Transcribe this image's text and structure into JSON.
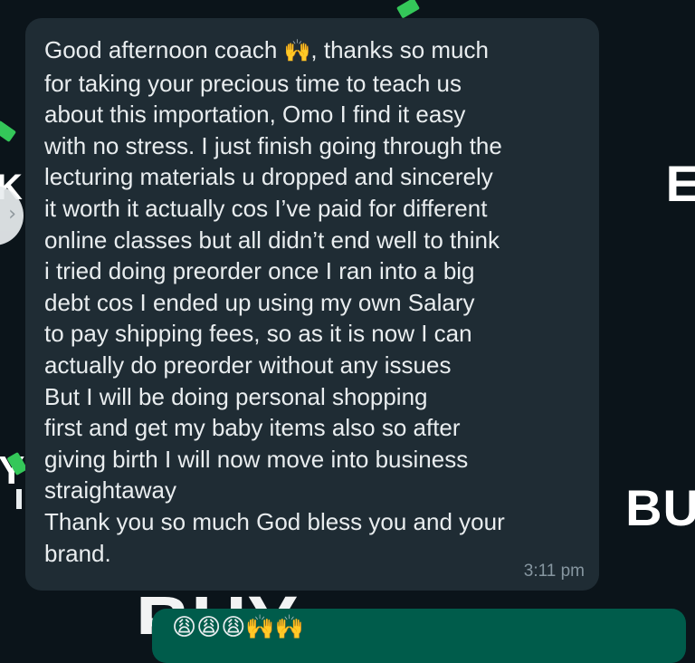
{
  "wallpaper": {
    "text_right_top": "E",
    "text_right_bottom": "BU",
    "text_bottom": "BUY",
    "text_left_top": "K",
    "text_left_bottom": "Y",
    "nav_arrow": "›"
  },
  "message": {
    "line_1a": "Good afternoon coach",
    "line_1_emoji": "🙌",
    "line_1b": ", thanks so much",
    "lines": [
      "for taking your precious time to teach us",
      "about this importation, Omo I find it easy",
      "with no stress. I just finish going through the",
      "lecturing materials u dropped and sincerely",
      "it worth it actually cos I’ve paid for different",
      "online classes but all didn’t end well to think",
      "i tried doing preorder once I ran into a big",
      "debt cos I ended up using my own Salary",
      "to pay shipping fees, so as it is now I can",
      "actually do preorder without any issues",
      "But I will be doing personal shopping",
      "first and get my baby items also so after",
      "giving birth I will now move into business",
      "straightaway",
      "Thank you so much God bless you and your",
      "brand."
    ],
    "time": "3:11 pm"
  },
  "next_message": {
    "preview": "😩😩😩🙌🙌"
  },
  "colors": {
    "background": "#0b141a",
    "bubble": "#1f2c34",
    "text": "#e9edef",
    "timestamp": "#8696a0",
    "next_bubble": "#005c4b"
  }
}
